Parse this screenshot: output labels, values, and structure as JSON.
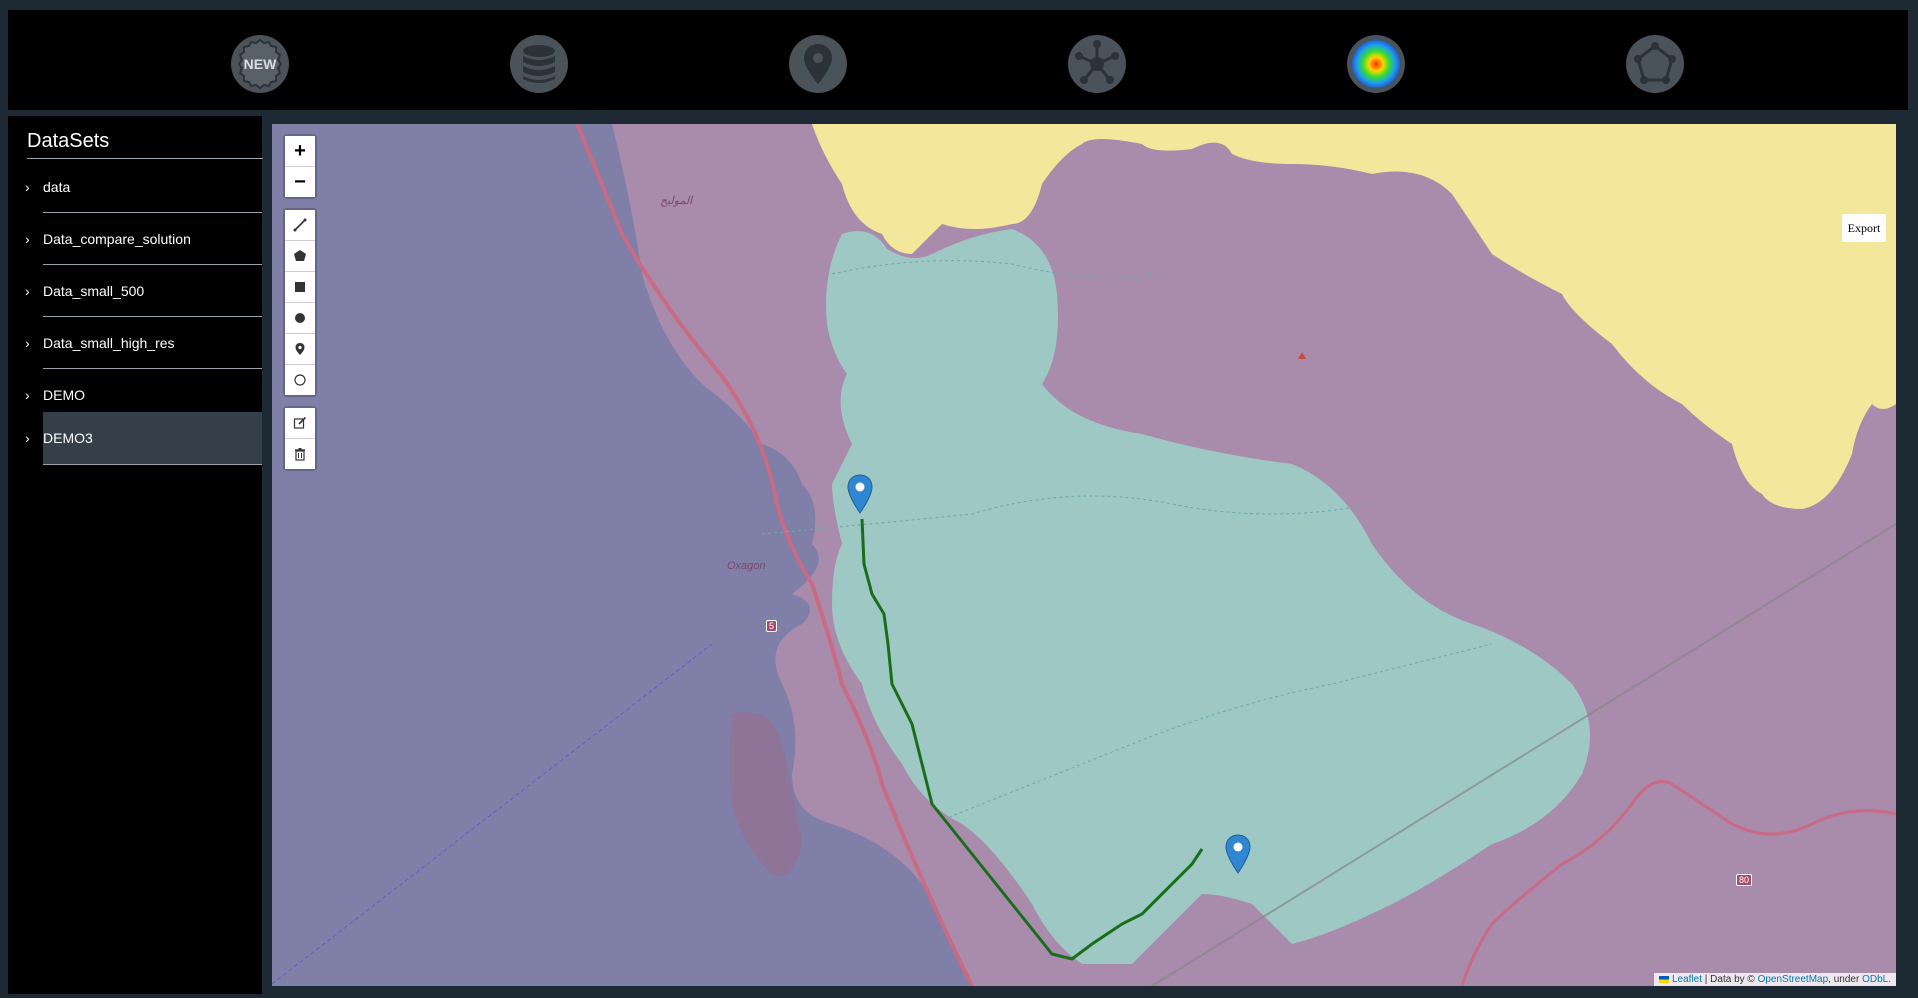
{
  "toolbar": {
    "buttons": [
      {
        "name": "new-dataset-button",
        "icon": "new-badge-icon",
        "label": "NEW"
      },
      {
        "name": "database-button",
        "icon": "database-icon"
      },
      {
        "name": "location-button",
        "icon": "map-pin-icon"
      },
      {
        "name": "network-button",
        "icon": "network-icon"
      },
      {
        "name": "heatmap-button",
        "icon": "heatmap-icon"
      },
      {
        "name": "polygon-button",
        "icon": "polygon-icon"
      }
    ]
  },
  "sidebar": {
    "title": "DataSets",
    "items": [
      {
        "label": "data"
      },
      {
        "label": "Data_compare_solution"
      },
      {
        "label": "Data_small_500"
      },
      {
        "label": "Data_small_high_res"
      },
      {
        "label": "DEMO"
      },
      {
        "label": "DEMO3",
        "selected": true
      }
    ]
  },
  "map": {
    "zoom_in": "+",
    "zoom_out": "−",
    "export_label": "Export",
    "labels": {
      "town": "Oxagon",
      "arabic_town": "الموليح",
      "route_5": "5",
      "route_80": "80"
    },
    "attribution": {
      "leaflet": "Leaflet",
      "data_by": " | Data by © ",
      "osm": "OpenStreetMap",
      "under": ", under ",
      "odbl": "ODbL."
    },
    "colors": {
      "sea": "#7f7fa8",
      "land": "#a98bac",
      "yellow_zone": "#f3e79b",
      "teal_zone": "#9dc8c4",
      "route": "#1a6e1a",
      "marker": "#2f86d1"
    }
  }
}
